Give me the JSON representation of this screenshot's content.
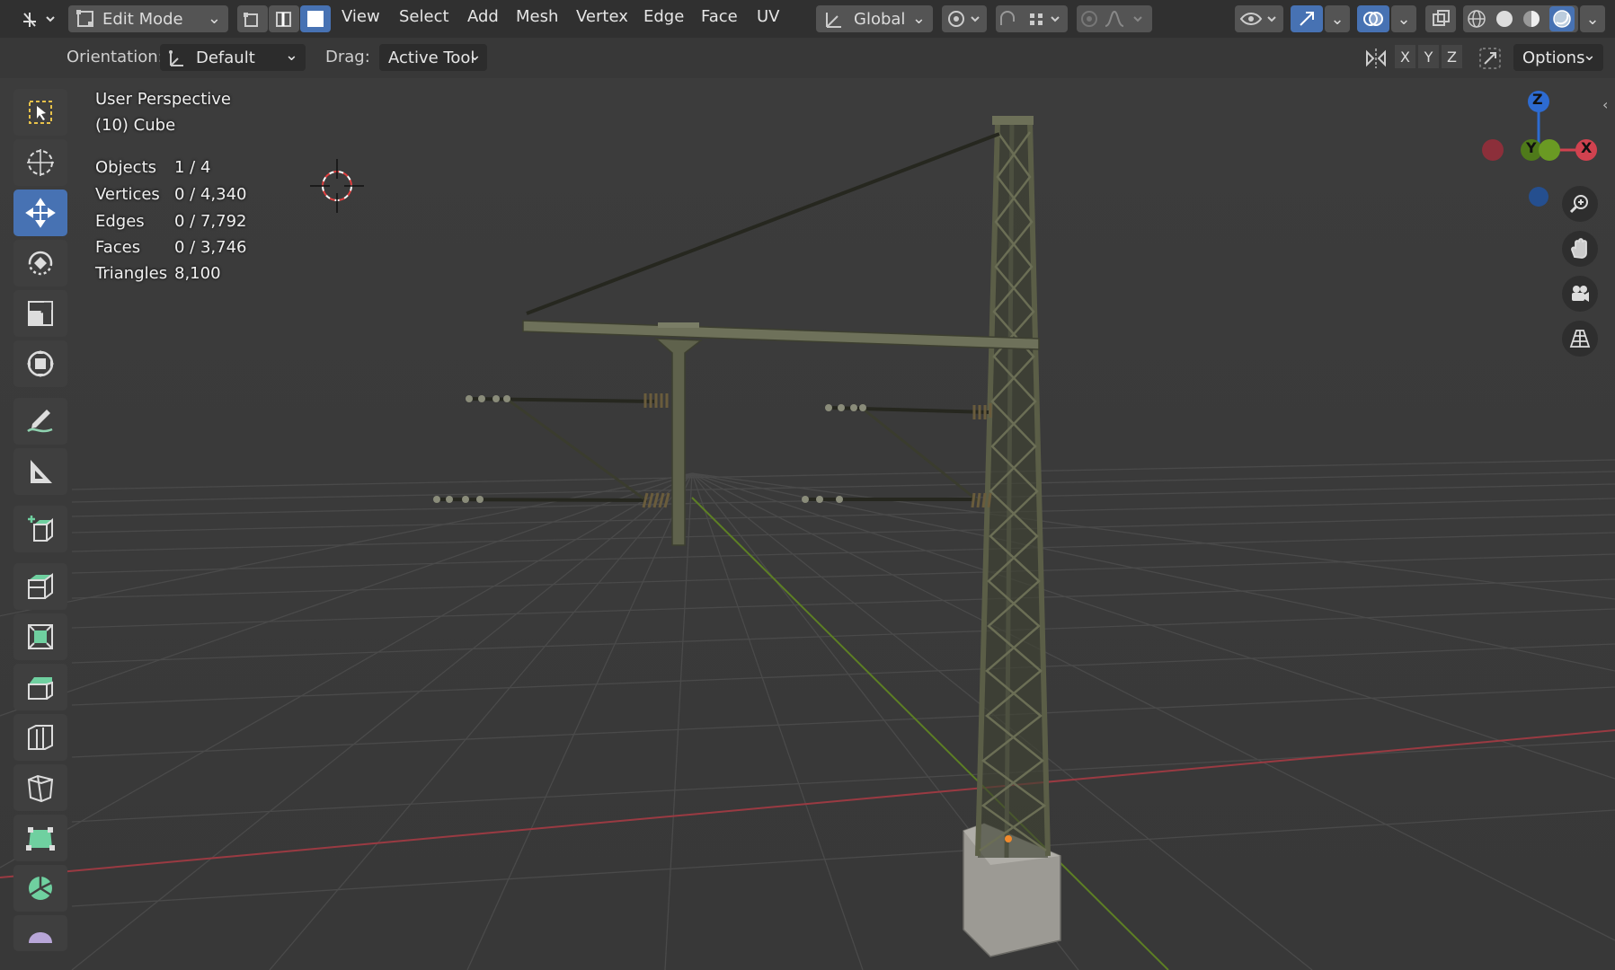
{
  "header": {
    "mode_label": "Edit Mode",
    "menus": [
      "View",
      "Select",
      "Add",
      "Mesh",
      "Vertex",
      "Edge",
      "Face",
      "UV"
    ],
    "transform_orientation": "Global"
  },
  "tool_settings": {
    "orientation_label": "Orientation:",
    "orientation_value": "Default",
    "drag_label": "Drag:",
    "drag_value": "Active Tool",
    "axis_x": "X",
    "axis_y": "Y",
    "axis_z": "Z",
    "options_label": "Options"
  },
  "overlay": {
    "view_name": "User Perspective",
    "object_name": "(10) Cube",
    "stats": [
      {
        "label": "Objects",
        "value": "1 / 4"
      },
      {
        "label": "Vertices",
        "value": "0 / 4,340"
      },
      {
        "label": "Edges",
        "value": "0 / 7,792"
      },
      {
        "label": "Faces",
        "value": "0 / 3,746"
      },
      {
        "label": "Triangles",
        "value": "8,100"
      }
    ]
  },
  "gizmo": {
    "z": "Z",
    "y": "Y",
    "x": "X"
  },
  "colors": {
    "accent": "#4772b3",
    "x_axis": "#d1424f",
    "y_axis": "#6a9a23",
    "z_axis": "#2d6bd1",
    "mesh": "#5b5e47"
  },
  "left_tools": [
    "select-box-icon",
    "cursor-icon",
    "move-icon",
    "rotate-icon",
    "scale-icon",
    "transform-icon",
    "annotate-icon",
    "measure-icon",
    "add-cube-icon",
    "extrude-icon",
    "inset-icon",
    "bevel-icon",
    "loop-cut-icon",
    "knife-icon",
    "poly-build-icon",
    "spin-icon",
    "smooth-icon"
  ]
}
